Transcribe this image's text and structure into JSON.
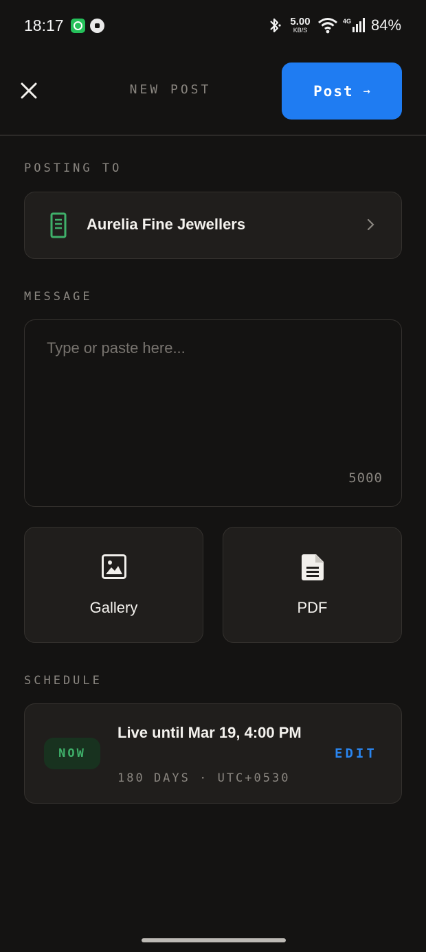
{
  "status_bar": {
    "time": "18:17",
    "network_speed": "5.00",
    "network_speed_unit": "KB/S",
    "network_type": "4G",
    "battery": "84%"
  },
  "header": {
    "title": "NEW POST",
    "post_label": "Post",
    "post_arrow": "→"
  },
  "posting_to": {
    "section_label": "POSTING TO",
    "account_name": "Aurelia Fine Jewellers",
    "icon": "document-icon"
  },
  "message": {
    "section_label": "MESSAGE",
    "placeholder": "Type or paste here...",
    "value": "",
    "char_counter": "5000"
  },
  "attachments": {
    "gallery_label": "Gallery",
    "pdf_label": "PDF"
  },
  "schedule": {
    "section_label": "SCHEDULE",
    "badge": "NOW",
    "title": "Live until Mar 19, 4:00 PM",
    "subtitle": "180 DAYS · UTC+0530",
    "edit_label": "EDIT"
  },
  "colors": {
    "background": "#141312",
    "card": "#201e1c",
    "accent_blue": "#1f7cf2",
    "success_green": "#3fb06a",
    "muted_text": "#8a8680"
  }
}
